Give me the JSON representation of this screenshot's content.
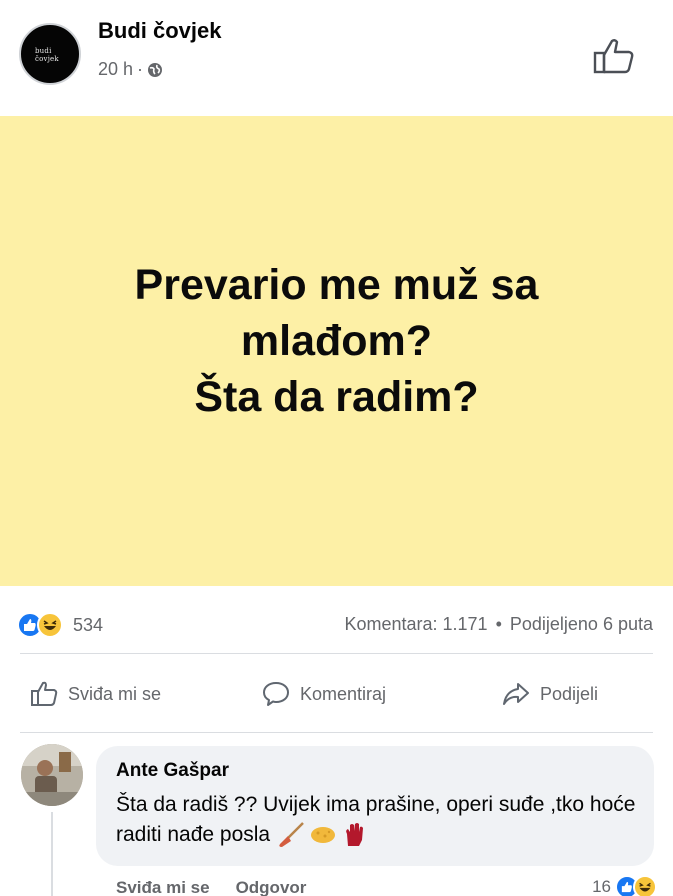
{
  "header": {
    "page_name": "Budi čovjek",
    "avatar_logo_line1": "budi",
    "avatar_logo_line2": "čovjek",
    "time": "20 h",
    "separator": "·",
    "audience_icon": "globe-icon",
    "like_icon": "thumbs-up-outline-icon"
  },
  "post": {
    "background_color": "#fdf0a6",
    "lines": [
      "Prevario me muž sa",
      "mlađom?",
      "Šta da radim?"
    ]
  },
  "stats": {
    "reaction_icons": [
      "like-icon",
      "haha-icon"
    ],
    "reaction_count": "534",
    "comments": "Komentara: 1.171",
    "dot": "•",
    "shares": "Podijeljeno 6 puta"
  },
  "actions": {
    "like_label": "Sviđa mi se",
    "comment_label": "Komentiraj",
    "share_label": "Podijeli"
  },
  "comment": {
    "author": "Ante Gašpar",
    "text": "Šta da radiš ?? Uvijek ima prašine, operi suđe ,tko hoće raditi nađe posla",
    "emojis": [
      "broom-emoji",
      "sponge-emoji",
      "glove-emoji"
    ],
    "like_label": "Sviđa mi se",
    "reply_label": "Odgovor",
    "reaction_count": "16"
  },
  "colors": {
    "accent_blue": "#1877f2",
    "muted_text": "#65676b",
    "haha_yellow": "#f7c43a"
  }
}
